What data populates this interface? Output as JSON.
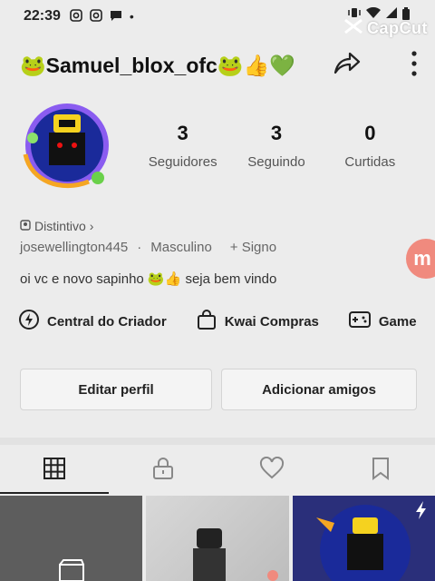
{
  "status": {
    "time": "22:39"
  },
  "watermark": "CapCut",
  "profile": {
    "username": "🐸Samuel_blox_ofc🐸👍💚",
    "stats": [
      {
        "num": "3",
        "label": "Seguidores"
      },
      {
        "num": "3",
        "label": "Seguindo"
      },
      {
        "num": "0",
        "label": "Curtidas"
      }
    ],
    "badge": "Distintivo",
    "handle": "josewellington445",
    "gender": "Masculino",
    "sign": "+ Signo",
    "bio": "oi vc e novo sapinho 🐸👍 seja bem vindo",
    "float_label": "m"
  },
  "shortcuts": [
    {
      "label": "Central do Criador",
      "icon": "lightning-icon"
    },
    {
      "label": "Kwai Compras",
      "icon": "shopping-bag-icon"
    },
    {
      "label": "Game",
      "icon": "gamepad-icon"
    }
  ],
  "buttons": {
    "edit": "Editar perfil",
    "add": "Adicionar amigos"
  },
  "tabs": [
    "grid-icon",
    "lock-icon",
    "heart-icon",
    "bookmark-icon"
  ],
  "colors": {
    "accent": "#f08a7e",
    "background": "#ececec"
  }
}
